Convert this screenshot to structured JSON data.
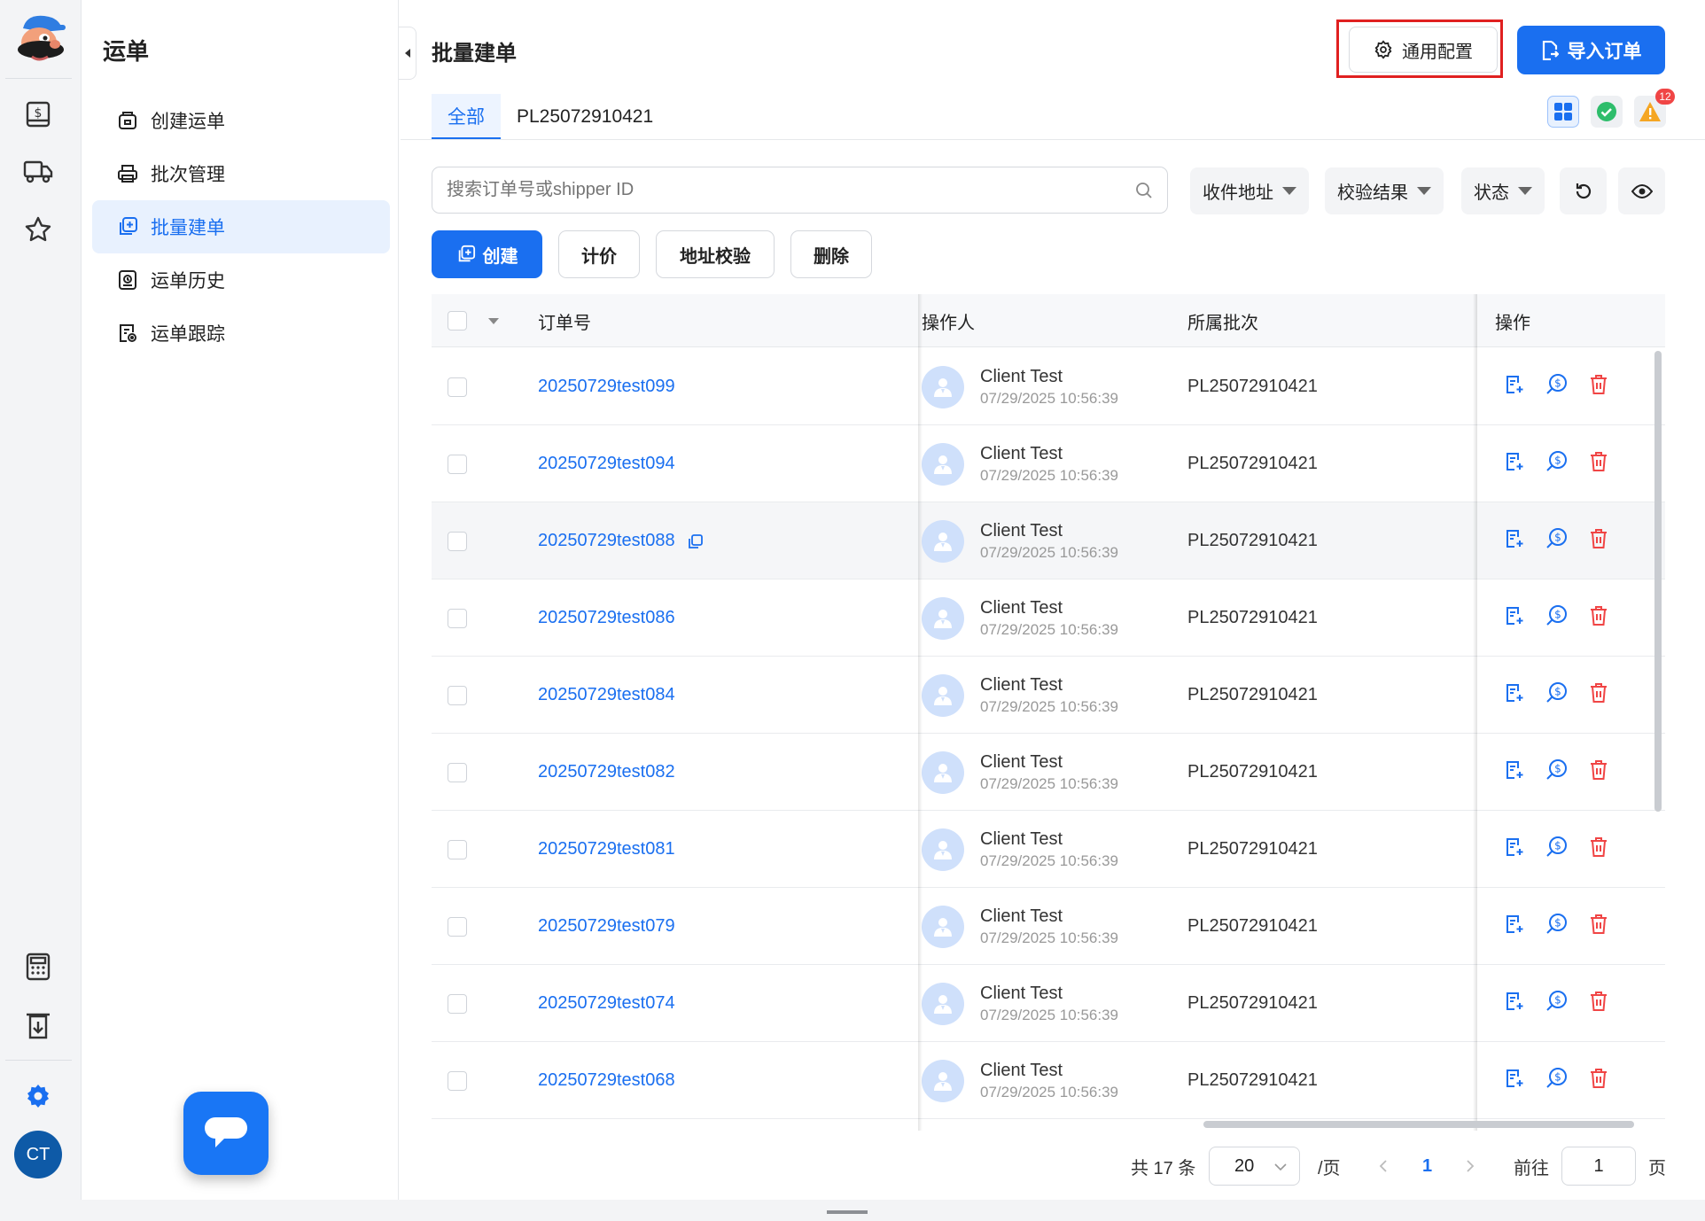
{
  "rail": {
    "top_icons": [
      "dollar-doc-icon",
      "truck-icon",
      "star-icon"
    ],
    "bottom_icons": [
      "calculator-icon",
      "download-doc-icon",
      "gear-icon"
    ],
    "avatar_initials": "CT"
  },
  "menu": {
    "title": "运单",
    "items": [
      {
        "label": "创建运单",
        "icon": "package-box-icon",
        "active": false
      },
      {
        "label": "批次管理",
        "icon": "printer-icon",
        "active": false
      },
      {
        "label": "批量建单",
        "icon": "batch-copy-icon",
        "active": true
      },
      {
        "label": "运单历史",
        "icon": "history-doc-icon",
        "active": false
      },
      {
        "label": "运单跟踪",
        "icon": "tracking-doc-icon",
        "active": false
      }
    ]
  },
  "header": {
    "title": "批量建单",
    "config_label": "通用配置",
    "import_label": "导入订单"
  },
  "tabs": [
    {
      "label": "全部",
      "active": true
    },
    {
      "label": "PL25072910421",
      "active": false
    }
  ],
  "status": {
    "warning_count": "12"
  },
  "toolbar": {
    "search_placeholder": "搜索订单号或shipper ID",
    "filters": [
      "收件地址",
      "校验结果",
      "状态"
    ],
    "create_label": "创建",
    "price_label": "计价",
    "verify_label": "地址校验",
    "delete_label": "删除"
  },
  "table": {
    "columns": [
      "订单号",
      "操作人",
      "所属批次",
      "操作"
    ],
    "rows": [
      {
        "order": "20250729test099",
        "operator": "Client Test",
        "time": "07/29/2025 10:56:39",
        "batch": "PL25072910421"
      },
      {
        "order": "20250729test094",
        "operator": "Client Test",
        "time": "07/29/2025 10:56:39",
        "batch": "PL25072910421"
      },
      {
        "order": "20250729test088",
        "operator": "Client Test",
        "time": "07/29/2025 10:56:39",
        "batch": "PL25072910421"
      },
      {
        "order": "20250729test086",
        "operator": "Client Test",
        "time": "07/29/2025 10:56:39",
        "batch": "PL25072910421"
      },
      {
        "order": "20250729test084",
        "operator": "Client Test",
        "time": "07/29/2025 10:56:39",
        "batch": "PL25072910421"
      },
      {
        "order": "20250729test082",
        "operator": "Client Test",
        "time": "07/29/2025 10:56:39",
        "batch": "PL25072910421"
      },
      {
        "order": "20250729test081",
        "operator": "Client Test",
        "time": "07/29/2025 10:56:39",
        "batch": "PL25072910421"
      },
      {
        "order": "20250729test079",
        "operator": "Client Test",
        "time": "07/29/2025 10:56:39",
        "batch": "PL25072910421"
      },
      {
        "order": "20250729test074",
        "operator": "Client Test",
        "time": "07/29/2025 10:56:39",
        "batch": "PL25072910421"
      },
      {
        "order": "20250729test068",
        "operator": "Client Test",
        "time": "07/29/2025 10:56:39",
        "batch": "PL25072910421"
      }
    ]
  },
  "pagination": {
    "total_text": "共 17 条",
    "page_size": "20",
    "per_page_suffix": "/页",
    "current_page": "1",
    "goto_label": "前往",
    "goto_value": "1",
    "page_suffix": "页"
  },
  "colors": {
    "primary": "#1a6ff0",
    "danger": "#f04545",
    "success": "#2ebd6b",
    "warning": "#f5a623",
    "highlight_box": "#e02020"
  }
}
